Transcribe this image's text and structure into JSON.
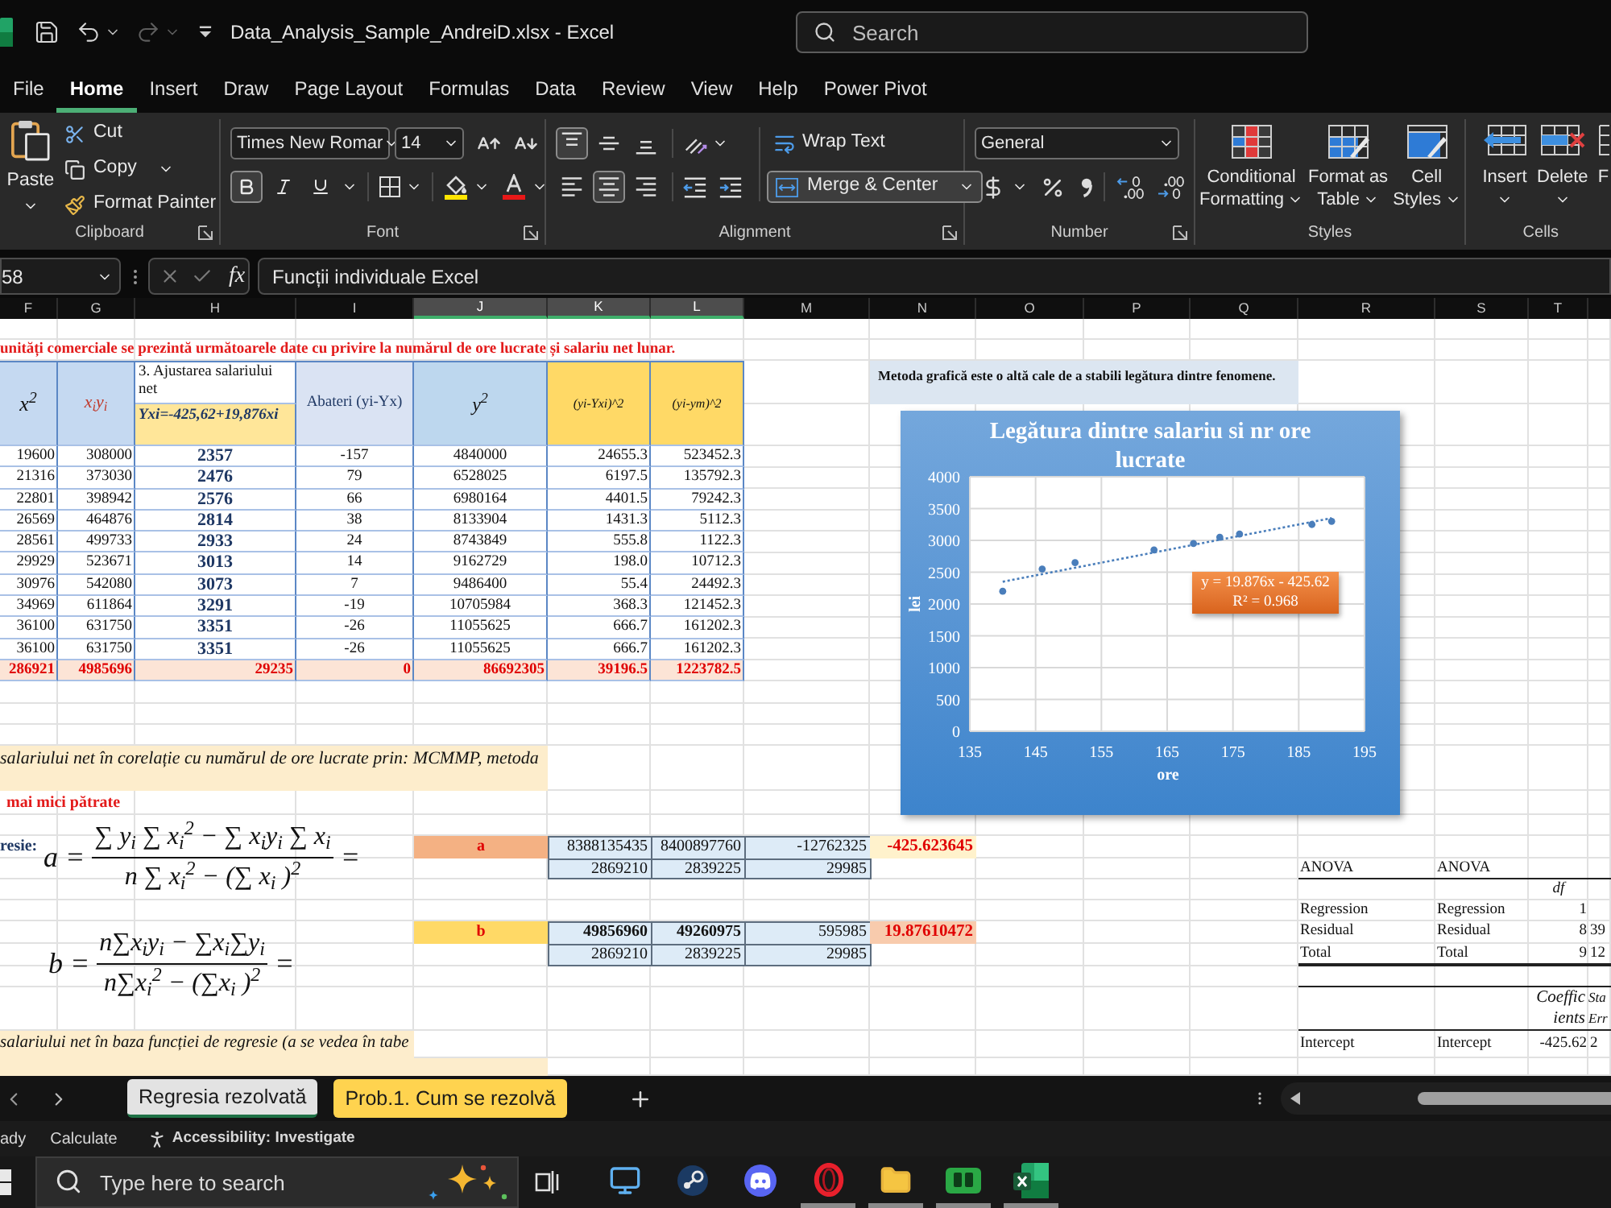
{
  "title_bar": {
    "title": "Data_Analysis_Sample_AndreiD.xlsx - Excel",
    "search": {
      "placeholder": "Search"
    }
  },
  "ribbon_tabs": [
    {
      "label": "File",
      "selected": false
    },
    {
      "label": "Home",
      "selected": true
    },
    {
      "label": "Insert",
      "selected": false
    },
    {
      "label": "Draw",
      "selected": false
    },
    {
      "label": "Page Layout",
      "selected": false
    },
    {
      "label": "Formulas",
      "selected": false
    },
    {
      "label": "Data",
      "selected": false
    },
    {
      "label": "Review",
      "selected": false
    },
    {
      "label": "View",
      "selected": false
    },
    {
      "label": "Help",
      "selected": false
    },
    {
      "label": "Power Pivot",
      "selected": false
    }
  ],
  "ribbon": {
    "clipboard": {
      "paste": "Paste",
      "cut": "Cut",
      "copy": "Copy",
      "format_painter": "Format Painter",
      "label": "Clipboard"
    },
    "font": {
      "font_name": "Times New Romar",
      "font_size": "14",
      "bold": true,
      "italic": false,
      "underline": false,
      "label": "Font"
    },
    "alignment": {
      "vertical": [
        {
          "kind": "top",
          "selected": true
        },
        {
          "kind": "middle",
          "selected": false
        },
        {
          "kind": "bottom",
          "selected": false
        }
      ],
      "horizontal": [
        {
          "kind": "left",
          "selected": false
        },
        {
          "kind": "center",
          "selected": true
        },
        {
          "kind": "right",
          "selected": false
        }
      ],
      "wrap_text": {
        "label": "Wrap Text",
        "on": false
      },
      "merge_center": {
        "label": "Merge & Center",
        "on": true
      },
      "label": "Alignment"
    },
    "number": {
      "format": "General",
      "label": "Number"
    },
    "styles": {
      "buttons": [
        {
          "kind": "conditional",
          "lines": [
            "Conditional",
            "Formatting"
          ]
        },
        {
          "kind": "table",
          "lines": [
            "Format as",
            "Table"
          ]
        },
        {
          "kind": "cell",
          "lines": [
            "Cell",
            "Styles"
          ]
        }
      ],
      "label": "Styles"
    },
    "cells": {
      "buttons": [
        {
          "kind": "insert",
          "label": "Insert"
        },
        {
          "kind": "delete",
          "label": "Delete"
        },
        {
          "kind": "format",
          "label": "F"
        }
      ],
      "label": "Cells"
    }
  },
  "formula_bar": {
    "name_box": "58",
    "function_label": "fx",
    "formula": "Funcții individuale Excel"
  },
  "sheet": {
    "columns": [
      {
        "label": "F",
        "selected": false
      },
      {
        "label": "G",
        "selected": false
      },
      {
        "label": "H",
        "selected": false
      },
      {
        "label": "I",
        "selected": false
      },
      {
        "label": "J",
        "selected": true
      },
      {
        "label": "K",
        "selected": true
      },
      {
        "label": "L",
        "selected": true
      },
      {
        "label": "M",
        "selected": false
      },
      {
        "label": "N",
        "selected": false
      },
      {
        "label": "O",
        "selected": false
      },
      {
        "label": "P",
        "selected": false
      },
      {
        "label": "Q",
        "selected": false
      },
      {
        "label": "R",
        "selected": false
      },
      {
        "label": "S",
        "selected": false
      },
      {
        "label": "T",
        "selected": false
      }
    ],
    "title": "unități comerciale se prezintă următoarele date cu privire la numărul de ore lucrate și salariu net lunar.",
    "table": {
      "headers": [
        "x$^{2}$",
        "x$_{i}$y$_{i}$",
        "3. Ajustarea salariului net",
        "Abateri (yi-Yx)",
        "y$^{2}$",
        "(yi-Yxi)^2",
        "(yi-ym)^2"
      ],
      "fitted_formula": "Yxi=-425,62+19,876xi",
      "rows": [
        [
          "19600",
          "308000",
          "2357",
          "-157",
          "4840000",
          "24655.3",
          "523452.3"
        ],
        [
          "21316",
          "373030",
          "2476",
          "79",
          "6528025",
          "6197.5",
          "135792.3"
        ],
        [
          "22801",
          "398942",
          "2576",
          "66",
          "6980164",
          "4401.5",
          "79242.3"
        ],
        [
          "26569",
          "464876",
          "2814",
          "38",
          "8133904",
          "1431.3",
          "5112.3"
        ],
        [
          "28561",
          "499733",
          "2933",
          "24",
          "8743849",
          "555.8",
          "1122.3"
        ],
        [
          "29929",
          "523671",
          "3013",
          "14",
          "9162729",
          "198.0",
          "10712.3"
        ],
        [
          "30976",
          "542080",
          "3073",
          "7",
          "9486400",
          "55.4",
          "24492.3"
        ],
        [
          "34969",
          "611864",
          "3291",
          "-19",
          "10705984",
          "368.3",
          "121452.3"
        ],
        [
          "36100",
          "631750",
          "3351",
          "-26",
          "11055625",
          "666.7",
          "161202.3"
        ],
        [
          "36100",
          "631750",
          "3351",
          "-26",
          "11055625",
          "666.7",
          "161202.3"
        ]
      ],
      "totals": [
        "286921",
        "4985696",
        "29235",
        "0",
        "86692305",
        "39196.5",
        "1223782.5"
      ]
    },
    "note": "Metoda grafică este o altă cale de a stabili legătura dintre fenomene.",
    "chart_data": {
      "type": "scatter",
      "title": "Legătura dintre salariu si nr ore lucrate",
      "xlabel": "ore",
      "ylabel": "lei",
      "xlim": [
        135,
        195
      ],
      "ylim": [
        0,
        4000
      ],
      "xticks": [
        135,
        145,
        155,
        165,
        175,
        185,
        195
      ],
      "yticks": [
        0,
        500,
        1000,
        1500,
        2000,
        2500,
        3000,
        3500,
        4000
      ],
      "grid": true,
      "series": [
        {
          "color": "#4a7ebb",
          "x": [
            140,
            146,
            151,
            163,
            169,
            173,
            176,
            187,
            190
          ],
          "values": [
            2200,
            2550,
            2650,
            2850,
            2950,
            3050,
            3100,
            3250,
            3300
          ]
        },
        {
          "type": "line",
          "line_style": "dotted",
          "color": "#4a7ebb",
          "x": [
            140,
            190
          ],
          "values": [
            2350,
            3350
          ]
        }
      ],
      "annotations": [
        "y = 19.876x - 425.62",
        "R² = 0.968"
      ]
    },
    "method_text": "salariului net în corelație cu numărul de ore lucrate prin: MCMMP, metoda",
    "method_heading": "mai mici pătrate",
    "regression_label": "resie:",
    "formulas": [
      {
        "lhs": "a =",
        "numerator": "∑ y$_{i}$ ∑ x$_{i}$$^{2}$ − ∑ x$_{i}$y$_{i}$ ∑ x$_{i}$",
        "denominator": "n ∑ x$_{i}$$^{2}$ − (∑ x$_{i}$ )$^{2}$",
        "rhs": "="
      },
      {
        "lhs": "b =",
        "numerator": "n∑x$_{i}$y$_{i}$ − ∑x$_{i}$∑y$_{i}$",
        "denominator": "n∑x$_{i}$$^{2}$ − (∑x$_{i}$ )$^{2}$",
        "rhs": "="
      }
    ],
    "coefficients": [
      {
        "label": "a",
        "numerators": [
          {
            "text": "8388135435",
            "bold": false
          },
          {
            "text": "8400897760",
            "bold": false
          },
          {
            "text": "-12762325",
            "bold": false
          }
        ],
        "denominators": [
          "2869210",
          "2839225",
          "29985"
        ],
        "result": "-425.623645"
      },
      {
        "label": "b",
        "numerators": [
          {
            "text": "49856960",
            "bold": true
          },
          {
            "text": "49260975",
            "bold": true
          },
          {
            "text": "595985",
            "bold": false
          }
        ],
        "denominators": [
          "2869210",
          "2839225",
          "29985"
        ],
        "result": "19.87610472"
      }
    ],
    "anova": {
      "headers": [
        "ANOVA",
        "ANOVA"
      ],
      "df_label": "df",
      "rows": [
        [
          "Regression",
          "Regression",
          "1"
        ],
        [
          "Residual",
          "Residual",
          "8",
          "39"
        ],
        [
          "Total",
          "Total",
          "9",
          "12"
        ]
      ],
      "coefficient_headers": [
        "Coefficients",
        "Sta Err"
      ],
      "intercept": [
        "Intercept",
        "Intercept",
        "-425.62",
        "2"
      ]
    },
    "conclusion_text": "salariului net în baza funcției de regresie (a se vedea în tabe"
  },
  "sheet_tabs": [
    {
      "label": "Regresia rezolvată",
      "selected": true
    },
    {
      "label": "Prob.1. Cum se rezolvă",
      "selected": false,
      "color": "#ffd34f"
    }
  ],
  "status_bar": {
    "mode": "ady",
    "calculate": "Calculate",
    "accessibility": "Accessibility: Investigate"
  },
  "taskbar": {
    "search": {
      "placeholder": "Type here to search"
    },
    "apps": [
      {
        "kind": "monitor",
        "running": false
      },
      {
        "kind": "disc",
        "running": false
      },
      {
        "kind": "chat",
        "running": false
      },
      {
        "kind": "ring",
        "running": true
      },
      {
        "kind": "folder",
        "running": true
      },
      {
        "kind": "board",
        "running": true
      },
      {
        "kind": "sheet",
        "running": true
      }
    ]
  }
}
